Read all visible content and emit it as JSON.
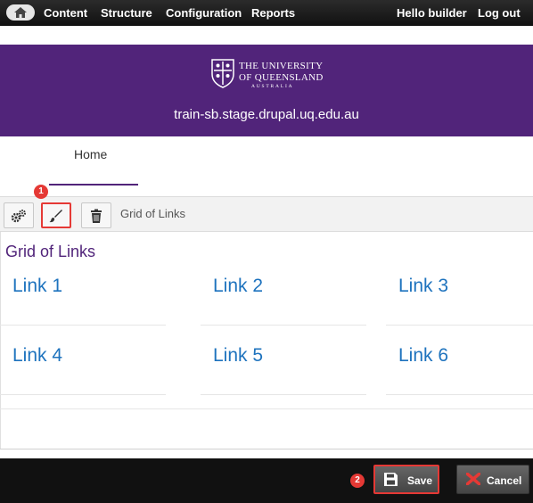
{
  "admin_bar": {
    "home_icon": "home-icon",
    "menu": [
      "Content",
      "Structure",
      "Configuration",
      "Reports"
    ],
    "user": "Hello builder",
    "logout": "Log out"
  },
  "header": {
    "logo_line1": "THE UNIVERSITY",
    "logo_line2": "OF QUEENSLAND",
    "logo_line3": "AUSTRALIA",
    "site_name": "train-sb.stage.drupal.uq.edu.au"
  },
  "nav": {
    "tabs": [
      {
        "label": "Home"
      }
    ]
  },
  "block_toolbar": {
    "buttons": [
      {
        "icon": "gears-icon"
      },
      {
        "icon": "paintbrush-icon"
      },
      {
        "icon": "trash-icon"
      }
    ],
    "label": "Grid of Links"
  },
  "annotations": {
    "badge1": "1",
    "badge2": "2"
  },
  "block": {
    "title": "Grid of Links",
    "links": [
      "Link 1",
      "Link 2",
      "Link 3",
      "Link 4",
      "Link 5",
      "Link 6"
    ]
  },
  "actions": {
    "save": "Save",
    "cancel": "Cancel"
  },
  "colors": {
    "brand_purple": "#51247a",
    "link_blue": "#1e73be",
    "highlight_red": "#e53935"
  }
}
